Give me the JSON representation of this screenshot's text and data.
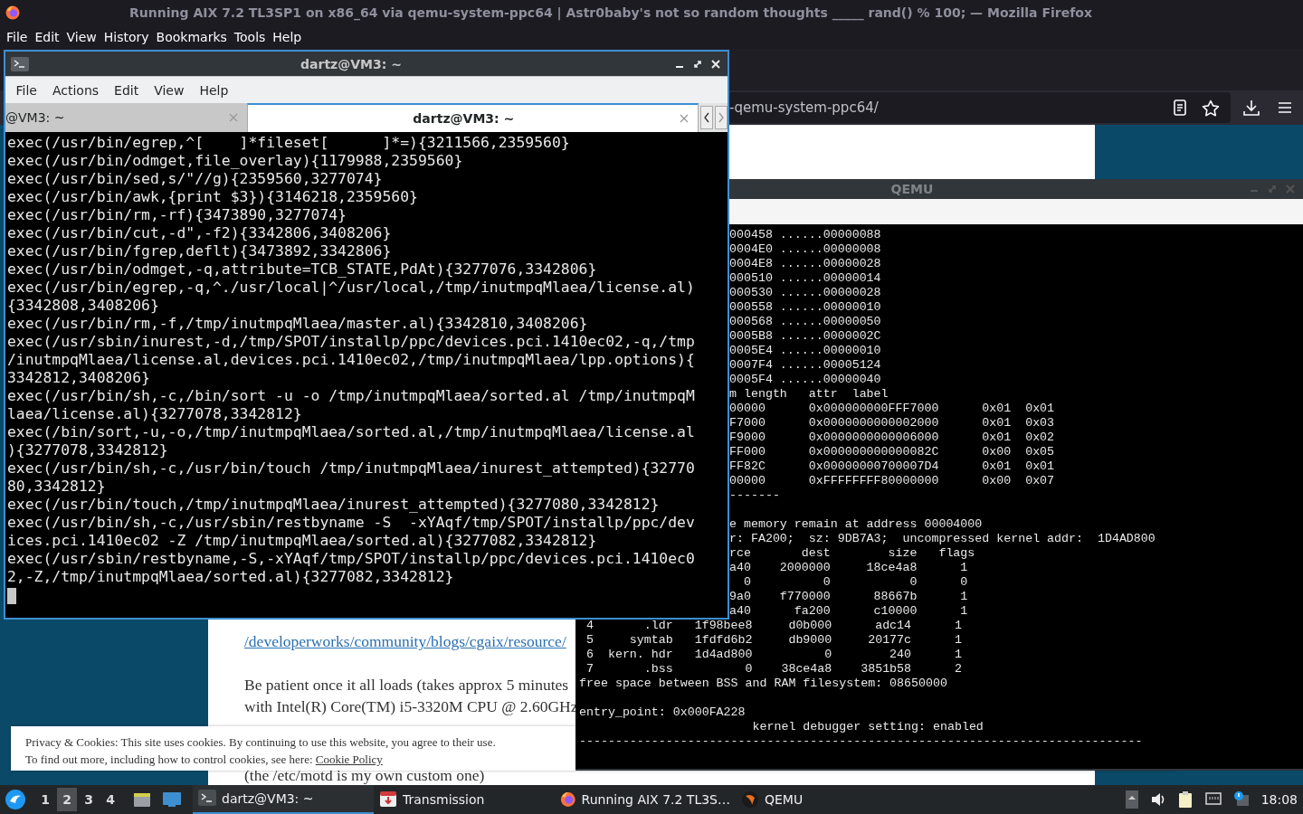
{
  "firefox": {
    "title": "Running AIX 7.2 TL3SP1 on x86_64 via qemu-system-ppc64 | Astr0baby's not so random thoughts _____ rand() % 100; — Mozilla Firefox",
    "menu": [
      "File",
      "Edit",
      "View",
      "History",
      "Bookmarks",
      "Tools",
      "Help"
    ],
    "url": "-qemu-system-ppc64/",
    "article": [
      [
        {
          "kind": "link",
          "text": "/developerworks/community/blogs/cgaix/resource/"
        }
      ],
      [
        {
          "kind": "text",
          "text": "Be patient once it all loads (takes approx 5 minutes"
        },
        {
          "kind": "text",
          "text": "with Intel(R) Core(TM) i5-3320M CPU @ 2.60GHz"
        }
      ]
    ],
    "cookie_notice": {
      "text": "Privacy & Cookies: This site uses cookies. By continuing to use this website, you agree to their use.",
      "more": "To find out more, including how to control cookies, see here:",
      "link": "Cookie Policy"
    },
    "article_tail": "(the /etc/motd is my own custom one)"
  },
  "terminal": {
    "title": "dartz@VM3: ~",
    "menu": [
      "File",
      "Actions",
      "Edit",
      "View",
      "Help"
    ],
    "tabs": [
      {
        "label": "@VM3: ~",
        "selected": false
      },
      {
        "label": "dartz@VM3: ~",
        "selected": true
      }
    ],
    "lines": [
      "exec(/usr/bin/egrep,^[    ]*fileset[      ]*=){3211566,2359560}",
      "exec(/usr/bin/odmget,file_overlay){1179988,2359560}",
      "exec(/usr/bin/sed,s/\"//g){2359560,3277074}",
      "exec(/usr/bin/awk,{print $3}){3146218,2359560}",
      "exec(/usr/bin/rm,-rf){3473890,3277074}",
      "exec(/usr/bin/cut,-d\",-f2){3342806,3408206}",
      "exec(/usr/bin/fgrep,deflt){3473892,3342806}",
      "exec(/usr/bin/odmget,-q,attribute=TCB_STATE,PdAt){3277076,3342806}",
      "exec(/usr/bin/egrep,-q,^./usr/local|^/usr/local,/tmp/inutmpqMlaea/license.al)",
      "{3342808,3408206}",
      "exec(/usr/bin/rm,-f,/tmp/inutmpqMlaea/master.al){3342810,3408206}",
      "exec(/usr/sbin/inurest,-d,/tmp/SPOT/installp/ppc/devices.pci.1410ec02,-q,/tmp",
      "/inutmpqMlaea/license.al,devices.pci.1410ec02,/tmp/inutmpqMlaea/lpp.options){",
      "3342812,3408206}",
      "exec(/usr/bin/sh,-c,/bin/sort -u -o /tmp/inutmpqMlaea/sorted.al /tmp/inutmpqM",
      "laea/license.al){3277078,3342812}",
      "exec(/bin/sort,-u,-o,/tmp/inutmpqMlaea/sorted.al,/tmp/inutmpqMlaea/license.al",
      "){3277078,3342812}",
      "exec(/usr/bin/sh,-c,/usr/bin/touch /tmp/inutmpqMlaea/inurest_attempted){32770",
      "80,3342812}",
      "exec(/usr/bin/touch,/tmp/inutmpqMlaea/inurest_attempted){3277080,3342812}",
      "exec(/usr/bin/sh,-c,/usr/sbin/restbyname -S  -xYAqf/tmp/SPOT/installp/ppc/dev",
      "ices.pci.1410ec02 -Z /tmp/inutmpqMlaea/sorted.al){3277082,3342812}",
      "exec(/usr/sbin/restbyname,-S,-xYAqf/tmp/SPOT/installp/ppc/devices.pci.1410ec0",
      "2,-Z,/tmp/inutmpqMlaea/sorted.al){3277082,3342812}"
    ]
  },
  "qemu": {
    "title": "QEMU",
    "lines_beside_terminal": [
      [
        {
          "text": "000458 ......00000088"
        },
        {
          "text": "0004E0 ......00000008"
        },
        {
          "text": "0004E8 ......00000028"
        },
        {
          "text": "000510 ......00000014"
        },
        {
          "text": "000530 ......00000028"
        },
        {
          "text": "000558 ......00000010"
        },
        {
          "text": "000568 ......00000050"
        },
        {
          "text": "0005B8 ......0000002C"
        },
        {
          "text": "0005E4 ......00000010"
        },
        {
          "text": "0007F4 ......00005124"
        },
        {
          "text": "0005F4 ......00000040"
        },
        {
          "text": "m length   attr  label"
        },
        {
          "text": "00000      0x000000000FFF7000      0x01  0x01"
        },
        {
          "text": "F7000      0x0000000000002000      0x01  0x03"
        },
        {
          "text": "F9000      0x0000000000006000      0x01  0x02"
        },
        {
          "text": "FF000      0x000000000000082C      0x00  0x05"
        },
        {
          "text": "FF82C      0x00000000700007D4      0x01  0x01"
        },
        {
          "text": "00000      0xFFFFFFFF80000000      0x00  0x07"
        },
        {
          "text": "-------"
        }
      ],
      [
        {
          "text": "e memory remain at address 00004000"
        },
        {
          "text": "r: FA200;  sz: 9DB7A3;  uncompressed kernel addr:  1D4AD800"
        },
        {
          "text": "rce       dest        size   flags"
        },
        {
          "text": "a40    2000000     18ce4a8      1"
        },
        {
          "text": "  0          0           0      0"
        },
        {
          "text": "9a0    f770000      88667b      1"
        },
        {
          "text": "a40      fa200      c10000      1"
        }
      ]
    ],
    "lines_below_terminal": [
      [
        {
          "text": " 4       .ldr   1f98bee8     d0b000      adc14      1"
        },
        {
          "text": " 5     symtab   1fdfd6b2     db9000     20177c      1"
        },
        {
          "text": " 6  kern. hdr   1d4ad800          0        240      1"
        },
        {
          "text": " 7       .bss          0    38ce4a8    3851b58      2"
        },
        {
          "text": "free space between BSS and RAM filesystem: 08650000"
        }
      ],
      [
        {
          "text": "entry_point: 0x000FA228"
        },
        {
          "text": "                        kernel debugger setting: enabled"
        },
        {
          "text": "------------------------------------------------------------------------------"
        }
      ]
    ]
  },
  "taskbar": {
    "workspaces": [
      {
        "label": "1",
        "selected": false
      },
      {
        "label": "2",
        "selected": true
      },
      {
        "label": "3",
        "selected": false
      },
      {
        "label": "4",
        "selected": false
      }
    ],
    "tasks": [
      {
        "kind": "terminal",
        "label": "dartz@VM3: ~",
        "selected": true
      },
      {
        "kind": "transmission",
        "label": "Transmission",
        "selected": false
      },
      {
        "kind": "browser",
        "label": "Running AIX 7.2 TL3S…",
        "selected": false
      },
      {
        "kind": "emulator",
        "label": "QEMU",
        "selected": false
      }
    ],
    "clock": "18:08"
  }
}
